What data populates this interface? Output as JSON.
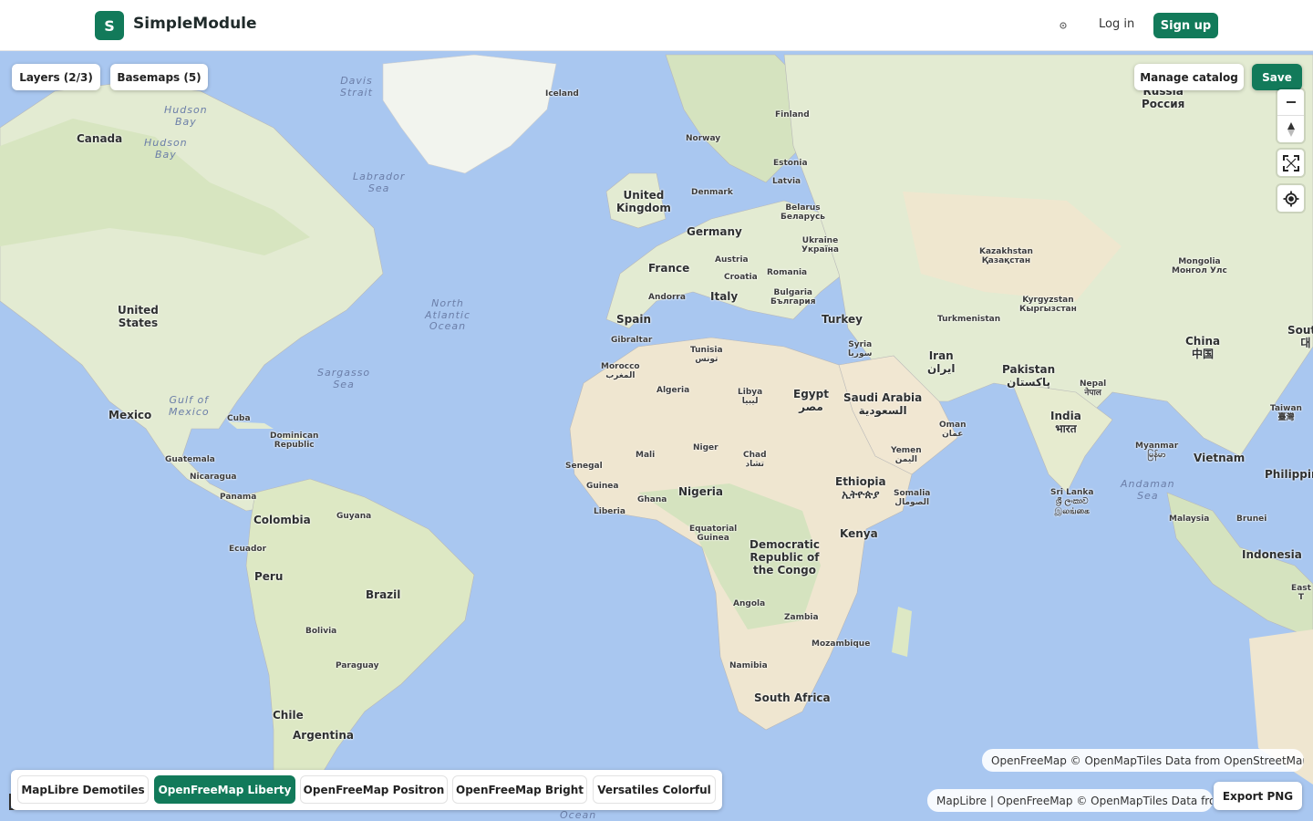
{
  "header": {
    "logo_letter": "S",
    "app_title": "SimpleModule",
    "theme_icon": "sun-icon",
    "login_label": "Log in",
    "signup_label": "Sign up"
  },
  "toolbar": {
    "layers_label": "Layers (2/3)",
    "basemaps_label": "Basemaps (5)",
    "manage_catalog_label": "Manage catalog",
    "save_label": "Save"
  },
  "map_controls": {
    "zoom_in_icon": "plus-icon",
    "zoom_out_icon": "minus-icon",
    "compass_icon": "compass-icon",
    "fullscreen_icon": "fullscreen-icon",
    "geolocate_icon": "locate-icon"
  },
  "map_labels": {
    "russia": "Russia\nРоссия",
    "iceland": "Iceland",
    "finland": "Finland",
    "norway": "Norway",
    "estonia": "Estonia",
    "latvia": "Latvia",
    "denmark": "Denmark",
    "united_kingdom": "United\nKingdom",
    "belarus": "Belarus\nБеларусь",
    "germany": "Germany",
    "ukraine": "Ukraine\nУкраїна",
    "austria": "Austria",
    "france": "France",
    "croatia": "Croatia",
    "romania": "Romania",
    "kazakhstan": "Kazakhstan\nҚазақстан",
    "mongolia": "Mongolia\nМонгол Улс",
    "andorra": "Andorra",
    "italy": "Italy",
    "bulgaria": "Bulgaria\nБългария",
    "kyrgyzstan": "Kyrgyzstan\nКыргызстан",
    "spain": "Spain",
    "turkey": "Turkey",
    "turkmenistan": "Turkmenistan",
    "gibraltar": "Gibraltar",
    "syria": "Syria\nسوريا",
    "china": "China\n中国",
    "south_korea": "South\n대",
    "tunisia": "Tunisia\nتونس",
    "iran": "Iran\nایران",
    "morocco": "Morocco\nالمغرب",
    "pakistan": "Pakistan\nپاکستان",
    "nepal": "Nepal\nनेपाल",
    "libya": "Libya\nليبيا",
    "algeria": "Algeria",
    "egypt": "Egypt\nمصر",
    "saudi_arabia": "Saudi Arabia\nالسعودية",
    "india": "India\nभारत",
    "taiwan": "Taiwan\n臺灣",
    "oman": "Oman\nعمان",
    "mali": "Mali",
    "niger": "Niger",
    "chad": "Chad\nتشاد",
    "myanmar": "Myanmar\nမြန်မာ",
    "yemen": "Yemen\nاليمن",
    "vietnam": "Vietnam",
    "philippines": "Philippine",
    "senegal": "Senegal",
    "ethiopia": "Ethiopia\nኢትዮጵያ",
    "guinea": "Guinea",
    "somalia": "Somalia\nالصومال",
    "nigeria": "Nigeria",
    "ghana": "Ghana",
    "sri_lanka": "Sri Lanka\nශ්‍රී ලංකාව\nஇலங்கை",
    "liberia": "Liberia",
    "malaysia": "Malaysia",
    "brunei": "Brunei",
    "equatorial_guinea": "Equatorial\nGuinea",
    "kenya": "Kenya",
    "drc": "Democratic\nRepublic of\nthe Congo",
    "indonesia": "Indonesia",
    "east_timor": "East T",
    "angola": "Angola",
    "zambia": "Zambia",
    "mozambique": "Mozambique",
    "namibia": "Namibia",
    "south_africa": "South Africa",
    "canada": "Canada",
    "united_states": "United\nStates",
    "mexico": "Mexico",
    "cuba": "Cuba",
    "dominican_republic": "Dominican\nRepublic",
    "guatemala": "Guatemala",
    "nicaragua": "Nicaragua",
    "panama": "Panama",
    "colombia": "Colombia",
    "guyana": "Guyana",
    "ecuador": "Ecuador",
    "peru": "Peru",
    "brazil": "Brazil",
    "bolivia": "Bolivia",
    "paraguay": "Paraguay",
    "chile": "Chile",
    "argentina": "Argentina"
  },
  "sea_labels": {
    "davis_strait": "Davis\nStrait",
    "hudson_bay_1": "Hudson\nBay",
    "hudson_bay_2": "Hudson\nBay",
    "labrador_sea": "Labrador\nSea",
    "north_atlantic": "North\nAtlantic\nOcean",
    "sargasso_sea": "Sargasso\nSea",
    "gulf_of_mexico": "Gulf of\nMexico",
    "andaman_sea": "Andaman\nSea",
    "ocean_bottom": "Ocean"
  },
  "attribution": {
    "top": "OpenFreeMap © OpenMapTiles Data from OpenStreetMap",
    "bottom": "MapLibre | OpenFreeMap © OpenMapTiles Data from Op",
    "info_icon": "info-icon"
  },
  "basemaps": {
    "items": [
      {
        "label": "MapLibre Demotiles",
        "active": false
      },
      {
        "label": "OpenFreeMap Liberty",
        "active": true
      },
      {
        "label": "OpenFreeMap Positron",
        "active": false
      },
      {
        "label": "OpenFreeMap Bright",
        "active": false
      },
      {
        "label": "Versatiles Colorful",
        "active": false
      }
    ]
  },
  "export_label": "Export PNG",
  "colors": {
    "brand": "#127a5a",
    "ocean": "#a9c7f0",
    "land": "#e8ecd6",
    "forest": "#d5e3bf",
    "desert": "#f0e8d6"
  }
}
